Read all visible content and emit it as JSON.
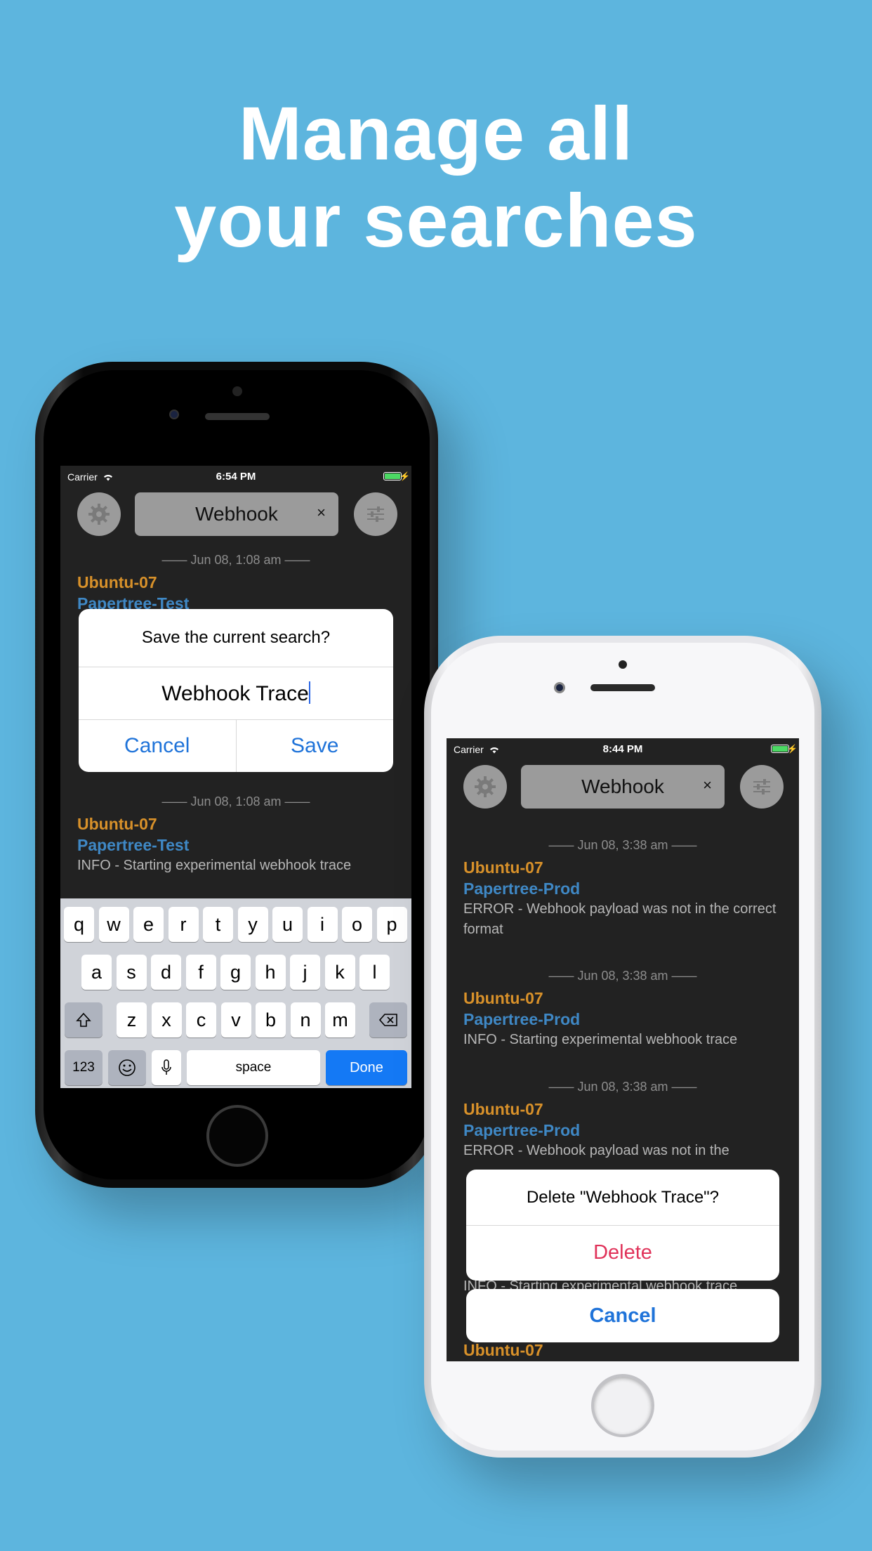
{
  "headline": {
    "line1": "Manage all",
    "line2": "your searches"
  },
  "phone1": {
    "status": {
      "carrier": "Carrier",
      "time": "6:54 PM"
    },
    "search": {
      "text": "Webhook",
      "clear": "×"
    },
    "entries": [
      {
        "date": "—— Jun 08, 1:08 am ——",
        "host": "Ubuntu-07",
        "system": "Papertree-Test",
        "message": ""
      },
      {
        "date": "—— Jun 08, 1:08 am ——",
        "host": "Ubuntu-07",
        "system": "Papertree-Test",
        "message": "INFO - Starting experimental webhook trace"
      }
    ],
    "dialog": {
      "title": "Save the current search?",
      "input": "Webhook Trace",
      "cancel": "Cancel",
      "save": "Save"
    },
    "keyboard": {
      "row1": [
        "q",
        "w",
        "e",
        "r",
        "t",
        "y",
        "u",
        "i",
        "o",
        "p"
      ],
      "row2": [
        "a",
        "s",
        "d",
        "f",
        "g",
        "h",
        "j",
        "k",
        "l"
      ],
      "row3": [
        "z",
        "x",
        "c",
        "v",
        "b",
        "n",
        "m"
      ],
      "numbers": "123",
      "space": "space",
      "done": "Done"
    }
  },
  "phone2": {
    "status": {
      "carrier": "Carrier",
      "time": "8:44 PM"
    },
    "search": {
      "text": "Webhook",
      "clear": "×"
    },
    "entries": [
      {
        "date": "—— Jun 08, 3:38 am ——",
        "host": "Ubuntu-07",
        "system": "Papertree-Prod",
        "message": "ERROR - Webhook payload was not in the correct format"
      },
      {
        "date": "—— Jun 08, 3:38 am ——",
        "host": "Ubuntu-07",
        "system": "Papertree-Prod",
        "message": "INFO - Starting experimental webhook trace"
      },
      {
        "date": "—— Jun 08, 3:38 am ——",
        "host": "Ubuntu-07",
        "system": "Papertree-Prod",
        "message": "ERROR - Webhook payload was not in the"
      },
      {
        "message": "INFO - Starting experimental webhook trace"
      },
      {
        "host": "Ubuntu-07"
      }
    ],
    "sheet": {
      "title": "Delete \"Webhook Trace\"?",
      "delete": "Delete",
      "cancel": "Cancel"
    }
  },
  "colors": {
    "background": "#5db5de",
    "host": "#d8912a",
    "system": "#3f88c5",
    "action": "#1f73d9",
    "destructive": "#e0335a",
    "battery": "#4cd964"
  }
}
